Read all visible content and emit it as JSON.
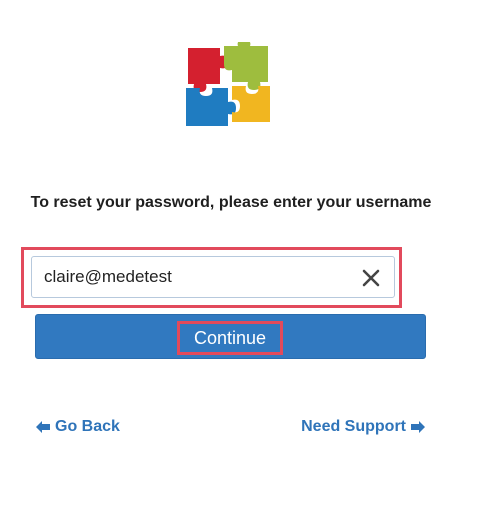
{
  "branding": {
    "logo_icon": "puzzle-logo-icon",
    "colors": {
      "red": "#d4202f",
      "green": "#9ebd3e",
      "blue": "#1f7cc1",
      "yellow": "#f1b620"
    }
  },
  "form": {
    "prompt": "To reset your password, please enter your username",
    "username_value": "claire@medetest",
    "clear_icon": "close-icon",
    "continue_label": "Continue"
  },
  "links": {
    "go_back": "Go Back",
    "need_support": "Need Support"
  },
  "colors": {
    "primary": "#3179c0",
    "link": "#2f74b9",
    "highlight": "#e24a5c"
  }
}
